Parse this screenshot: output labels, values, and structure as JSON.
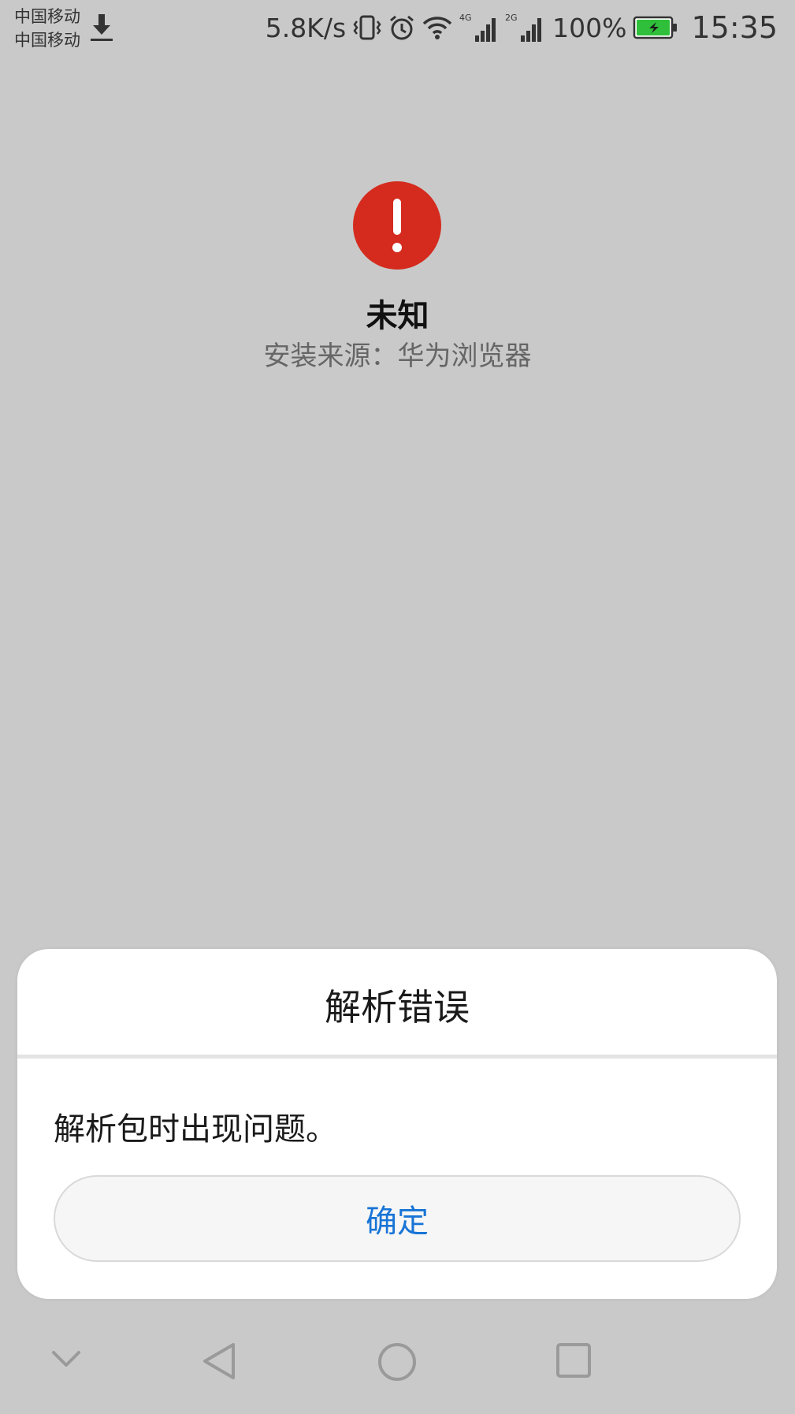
{
  "status_bar": {
    "carrier_1": "中国移动",
    "carrier_2": "中国移动",
    "network_speed": "5.8K/s",
    "signal_1_type": "4G",
    "signal_2_type": "2G",
    "battery_percent": "100%",
    "time": "15:35",
    "icons": [
      "download-icon",
      "vibrate-icon",
      "alarm-icon",
      "wifi-icon",
      "signal-4g-icon",
      "signal-2g-icon",
      "battery-charging-icon"
    ]
  },
  "app_info": {
    "icon": "alert-circle-icon",
    "name": "未知",
    "install_source": "安装来源：华为浏览器"
  },
  "dialog": {
    "title": "解析错误",
    "message": "解析包时出现问题。",
    "confirm_label": "确定"
  },
  "nav_bar": {
    "icons": [
      "chevron-down-icon",
      "back-icon",
      "home-icon",
      "recents-icon"
    ]
  },
  "colors": {
    "background": "#c9c9c9",
    "alert_red": "#d42b1e",
    "accent_blue": "#1874d6",
    "battery_green": "#2fbf3a"
  }
}
